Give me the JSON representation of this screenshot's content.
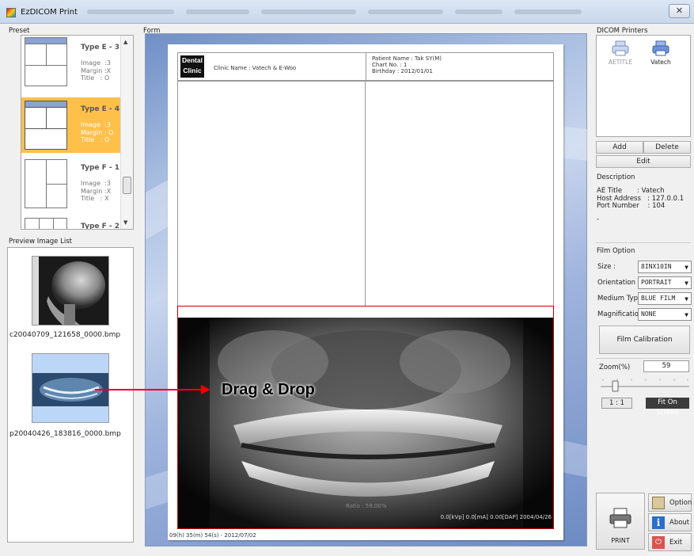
{
  "window": {
    "title": "EzDICOM Print",
    "close": "✕"
  },
  "preset": {
    "label": "Preset",
    "items": [
      {
        "name": "Type E - 3",
        "meta": "Image  :3\nMargin :X\nTitle   : O",
        "selected": false
      },
      {
        "name": "Type E - 4",
        "meta": "Image  :3\nMargin : O\nTitle   : O",
        "selected": true
      },
      {
        "name": "Type F - 1",
        "meta": "Image  :3\nMargin :X\nTitle   : X",
        "selected": false
      },
      {
        "name": "Type F - 2",
        "meta": "",
        "selected": false
      }
    ]
  },
  "preview": {
    "label": "Preview Image List",
    "images": [
      {
        "filename": "c20040709_121658_0000.bmp"
      },
      {
        "filename": "p20040426_183816_0000.bmp"
      }
    ]
  },
  "form": {
    "label": "Form",
    "logo_line1": "Dental",
    "logo_line2": "Clinic",
    "clinic_name": "Clinic Name : Vatech & E-Woo",
    "patient_name": "Patient Name : Tak SY(M)",
    "chart_no": "Chart No. : 1",
    "birthday": "Birthday : 2012/01/01",
    "drag_drop": "Drag & Drop",
    "ratio": "Ratio : 59.00%",
    "exposure": "0.0[kVp] 0.0[mA] 0.00[DAP] 2004/04/26",
    "footer_timestamp": "09(h) 35(m) 54(s) - 2012/07/02"
  },
  "dicom_printers": {
    "label": "DICOM Printers",
    "printers": [
      {
        "name": "AETITLE",
        "active": false
      },
      {
        "name": "Vatech",
        "active": true
      }
    ],
    "add": "Add",
    "delete": "Delete",
    "edit": "Edit"
  },
  "description": {
    "label": "Description",
    "text": "AE Title       : Vatech\nHost Address   : 127.0.0.1\nPort Number    : 104",
    "dash": "-"
  },
  "film_option": {
    "label": "Film Option",
    "size_label": "Size :",
    "size_value": "8INX10IN",
    "orientation_label": "Orientation :",
    "orientation_value": "PORTRAIT",
    "medium_label": "Medium Type :",
    "medium_value": "BLUE FILM",
    "magnification_label": "Magnification :",
    "magnification_value": "NONE",
    "calibration": "Film Calibration"
  },
  "zoom": {
    "label": "Zoom(%)",
    "value": "59",
    "one_to_one": "1 : 1",
    "fit": "Fit On Screen"
  },
  "actions": {
    "print": "PRINT",
    "option": "Option",
    "about": "About",
    "exit": "Exit"
  },
  "colors": {
    "selected_preset": "#ffc04a",
    "drop_border": "#cc0000",
    "form_bg": "#a7bde0"
  }
}
